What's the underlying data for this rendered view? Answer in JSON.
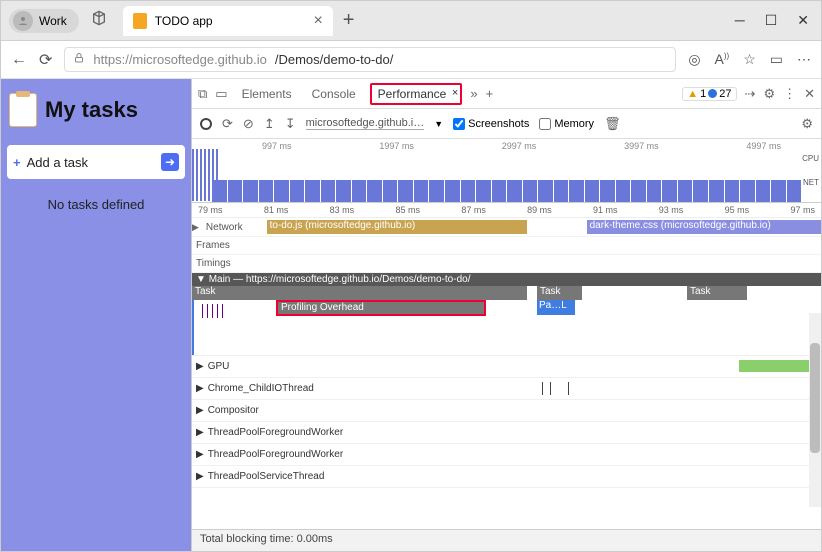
{
  "titlebar": {
    "work_label": "Work",
    "tab_title": "TODO app"
  },
  "url": {
    "host": "https://microsoftedge.github.io",
    "path": "/Demos/demo-to-do/"
  },
  "app": {
    "title": "My tasks",
    "add_label": "Add a task",
    "empty": "No tasks defined"
  },
  "devtools": {
    "tabs": {
      "elements": "Elements",
      "console": "Console",
      "performance": "Performance"
    },
    "warn_count": "1",
    "info_count": "27",
    "toolbar": {
      "url_short": "microsoftedge.github.i…",
      "screenshots": "Screenshots",
      "memory": "Memory"
    },
    "overview_ticks": [
      "997 ms",
      "1997 ms",
      "2997 ms",
      "3997 ms",
      "4997 ms"
    ],
    "overview_labels": {
      "cpu": "CPU",
      "net": "NET"
    },
    "ruler": [
      "79 ms",
      "81 ms",
      "83 ms",
      "85 ms",
      "87 ms",
      "89 ms",
      "91 ms",
      "93 ms",
      "95 ms",
      "97 ms"
    ],
    "tracks": {
      "network": "Network",
      "frames": "Frames",
      "timings": "Timings"
    },
    "net_items": {
      "a": "to-do.js (microsoftedge.github.io)",
      "b": "dark-theme.css (microsoftedge.github.io)"
    },
    "main_label": "Main — https://microsoftedge.github.io/Demos/demo-to-do/",
    "task_label": "Task",
    "profiling": "Profiling Overhead",
    "pal": "Pa…L",
    "threads": {
      "gpu": "GPU",
      "childio": "Chrome_ChildIOThread",
      "comp": "Compositor",
      "tpfg1": "ThreadPoolForegroundWorker",
      "tpfg2": "ThreadPoolForegroundWorker",
      "tpservice": "ThreadPoolServiceThread"
    },
    "footer": "Total blocking time: 0.00ms"
  }
}
